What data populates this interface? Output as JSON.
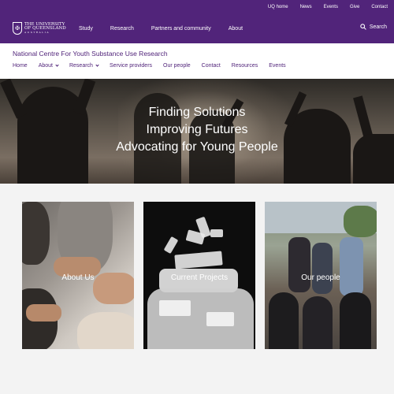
{
  "utility": {
    "links": [
      "UQ home",
      "News",
      "Events",
      "Give",
      "Contact"
    ]
  },
  "brand": {
    "line1": "THE UNIVERSITY",
    "line2": "OF QUEENSLAND",
    "line3": "AUSTRALIA",
    "color": "#51247a"
  },
  "mainnav": {
    "items": [
      "Study",
      "Research",
      "Partners and community",
      "About"
    ],
    "search_label": "Search"
  },
  "site": {
    "title": "National Centre For Youth Substance Use Research",
    "nav": [
      {
        "label": "Home",
        "dropdown": false
      },
      {
        "label": "About",
        "dropdown": true
      },
      {
        "label": "Research",
        "dropdown": true
      },
      {
        "label": "Service providers",
        "dropdown": false
      },
      {
        "label": "Our people",
        "dropdown": false
      },
      {
        "label": "Contact",
        "dropdown": false
      },
      {
        "label": "Resources",
        "dropdown": false
      },
      {
        "label": "Events",
        "dropdown": false
      }
    ]
  },
  "hero": {
    "line1": "Finding Solutions",
    "line2": "Improving Futures",
    "line3": "Advocating for Young People"
  },
  "cards": [
    {
      "label": "About Us"
    },
    {
      "label": "Current Projects"
    },
    {
      "label": "Our people"
    }
  ]
}
